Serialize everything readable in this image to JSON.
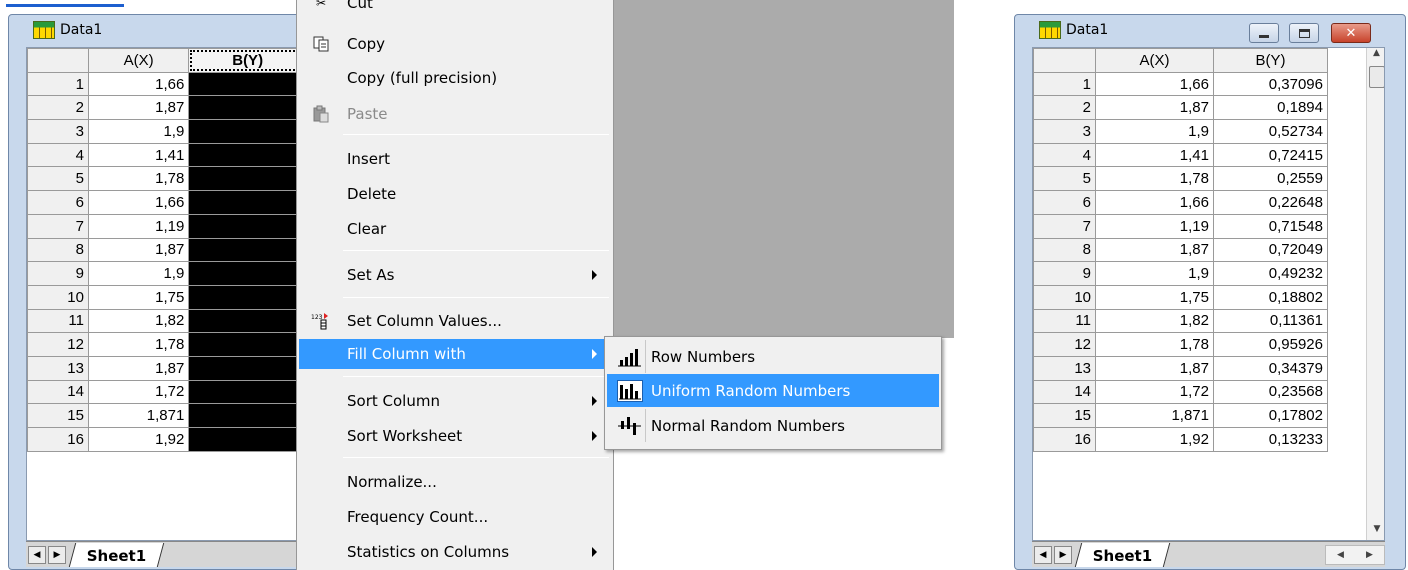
{
  "left_window": {
    "title": "Data1",
    "columns": [
      "A(X)",
      "B(Y)"
    ],
    "rows": [
      {
        "n": "1",
        "a": "1,66"
      },
      {
        "n": "2",
        "a": "1,87"
      },
      {
        "n": "3",
        "a": "1,9"
      },
      {
        "n": "4",
        "a": "1,41"
      },
      {
        "n": "5",
        "a": "1,78"
      },
      {
        "n": "6",
        "a": "1,66"
      },
      {
        "n": "7",
        "a": "1,19"
      },
      {
        "n": "8",
        "a": "1,87"
      },
      {
        "n": "9",
        "a": "1,9"
      },
      {
        "n": "10",
        "a": "1,75"
      },
      {
        "n": "11",
        "a": "1,82"
      },
      {
        "n": "12",
        "a": "1,78"
      },
      {
        "n": "13",
        "a": "1,87"
      },
      {
        "n": "14",
        "a": "1,72"
      },
      {
        "n": "15",
        "a": "1,871"
      },
      {
        "n": "16",
        "a": "1,92"
      }
    ],
    "sheet_tab": "Sheet1"
  },
  "context_menu": {
    "items": [
      {
        "label": "Cut",
        "icon": "scissors-icon",
        "disabled": false
      },
      {
        "label": "Copy",
        "icon": "copy-icon",
        "disabled": false
      },
      {
        "label": "Copy (full precision)",
        "icon": "",
        "disabled": false
      },
      {
        "label": "Paste",
        "icon": "paste-icon",
        "disabled": true
      },
      {
        "label": "Insert",
        "icon": "",
        "disabled": false
      },
      {
        "label": "Delete",
        "icon": "",
        "disabled": false
      },
      {
        "label": "Clear",
        "icon": "",
        "disabled": false
      },
      {
        "label": "Set As",
        "icon": "",
        "submenu": true
      },
      {
        "label": "Set Column Values...",
        "icon": "set-column-values-icon"
      },
      {
        "label": "Fill Column with",
        "icon": "",
        "submenu": true,
        "highlighted": true
      },
      {
        "label": "Sort Column",
        "icon": "",
        "submenu": true
      },
      {
        "label": "Sort Worksheet",
        "icon": "",
        "submenu": true
      },
      {
        "label": "Normalize...",
        "icon": ""
      },
      {
        "label": "Frequency Count...",
        "icon": ""
      },
      {
        "label": "Statistics on Columns",
        "icon": "",
        "submenu": true
      }
    ]
  },
  "submenu": {
    "items": [
      {
        "label": "Row Numbers",
        "icon": "row-numbers-icon"
      },
      {
        "label": "Uniform Random Numbers",
        "icon": "uniform-random-icon",
        "highlighted": true
      },
      {
        "label": "Normal Random Numbers",
        "icon": "normal-random-icon"
      }
    ]
  },
  "right_window": {
    "title": "Data1",
    "columns": [
      "A(X)",
      "B(Y)"
    ],
    "rows": [
      {
        "n": "1",
        "a": "1,66",
        "b": "0,37096"
      },
      {
        "n": "2",
        "a": "1,87",
        "b": "0,1894"
      },
      {
        "n": "3",
        "a": "1,9",
        "b": "0,52734"
      },
      {
        "n": "4",
        "a": "1,41",
        "b": "0,72415"
      },
      {
        "n": "5",
        "a": "1,78",
        "b": "0,2559"
      },
      {
        "n": "6",
        "a": "1,66",
        "b": "0,22648"
      },
      {
        "n": "7",
        "a": "1,19",
        "b": "0,71548"
      },
      {
        "n": "8",
        "a": "1,87",
        "b": "0,72049"
      },
      {
        "n": "9",
        "a": "1,9",
        "b": "0,49232"
      },
      {
        "n": "10",
        "a": "1,75",
        "b": "0,18802"
      },
      {
        "n": "11",
        "a": "1,82",
        "b": "0,11361"
      },
      {
        "n": "12",
        "a": "1,78",
        "b": "0,95926"
      },
      {
        "n": "13",
        "a": "1,87",
        "b": "0,34379"
      },
      {
        "n": "14",
        "a": "1,72",
        "b": "0,23568"
      },
      {
        "n": "15",
        "a": "1,871",
        "b": "0,17802"
      },
      {
        "n": "16",
        "a": "1,92",
        "b": "0,13233"
      }
    ],
    "sheet_tab": "Sheet1"
  },
  "colors": {
    "highlight": "#3399ff",
    "window_frame": "#c8d8ec",
    "gray_workspace": "#ababab"
  }
}
